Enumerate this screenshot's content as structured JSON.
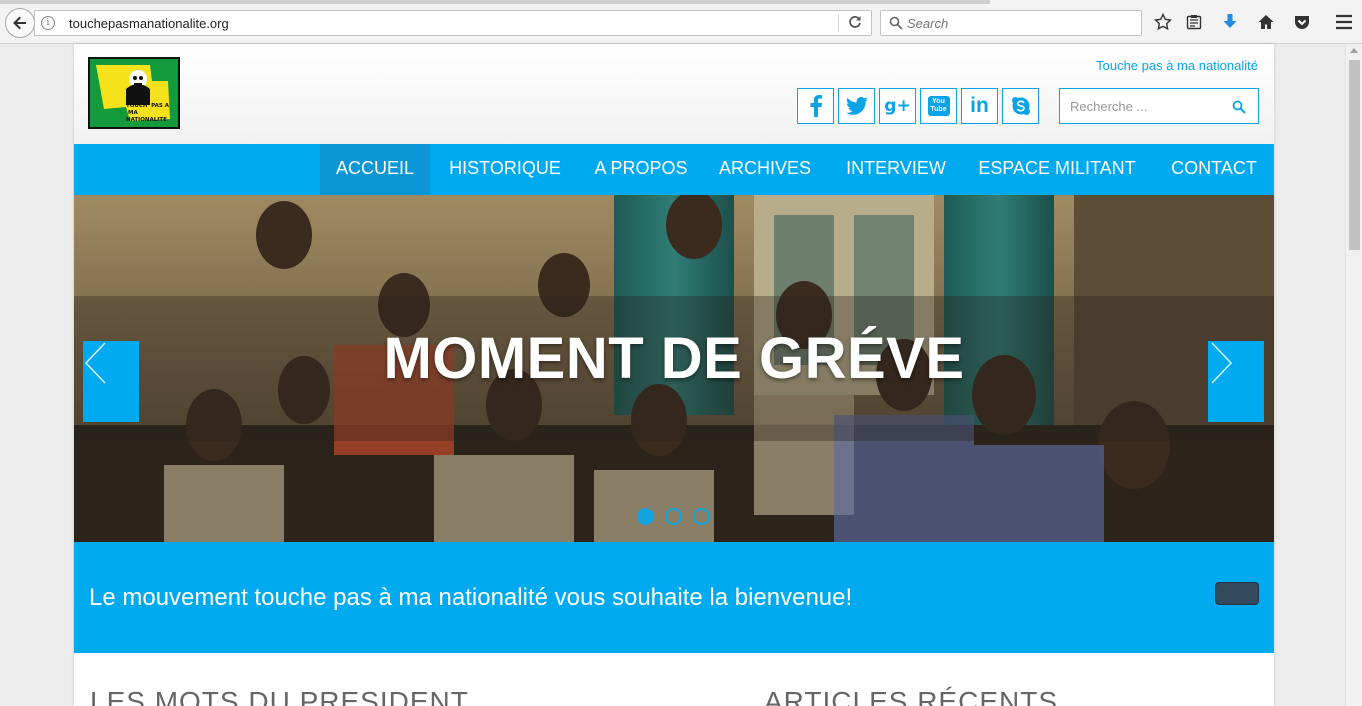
{
  "browser": {
    "url": "touchepasmanationalite.org",
    "search_placeholder": "Search",
    "icons": [
      "back-arrow-icon",
      "info-icon",
      "reload-icon",
      "search-icon",
      "star-icon",
      "reading-list-icon",
      "download-icon",
      "home-icon",
      "pocket-icon",
      "menu-icon"
    ]
  },
  "header": {
    "logo_lines": [
      "TOUCH' PAS A",
      "MA",
      "NATIONALITE"
    ],
    "tagline": "Touche pas à ma nationalité",
    "social": [
      "facebook-icon",
      "twitter-icon",
      "google-plus-icon",
      "youtube-icon",
      "linkedin-icon",
      "skype-icon"
    ],
    "social_text": {
      "google_plus": "g+",
      "youtube": "You Tube",
      "linkedin": "in"
    },
    "search_placeholder": "Recherche ..."
  },
  "nav": {
    "items": [
      {
        "label": "ACCUEIL",
        "active": true
      },
      {
        "label": "HISTORIQUE",
        "active": false
      },
      {
        "label": "A PROPOS",
        "active": false
      },
      {
        "label": "ARCHIVES",
        "active": false
      },
      {
        "label": "INTERVIEW",
        "active": false
      },
      {
        "label": "ESPACE MILITANT",
        "active": false
      },
      {
        "label": "CONTACT",
        "active": false
      }
    ]
  },
  "slider": {
    "title": "MOMENT DE GRÉVE",
    "slide_count": 3,
    "active_slide": 1
  },
  "welcome": {
    "text": "Le mouvement touche pas à ma nationalité vous souhaite la bienvenue!"
  },
  "sections": {
    "president": "LES MOTS DU PRESIDENT",
    "recent": "ARTICLES RÉCENTS"
  },
  "colors": {
    "accent": "#00aaf0",
    "nav_active": "#0b96d6",
    "welcome_button": "#33495e"
  }
}
